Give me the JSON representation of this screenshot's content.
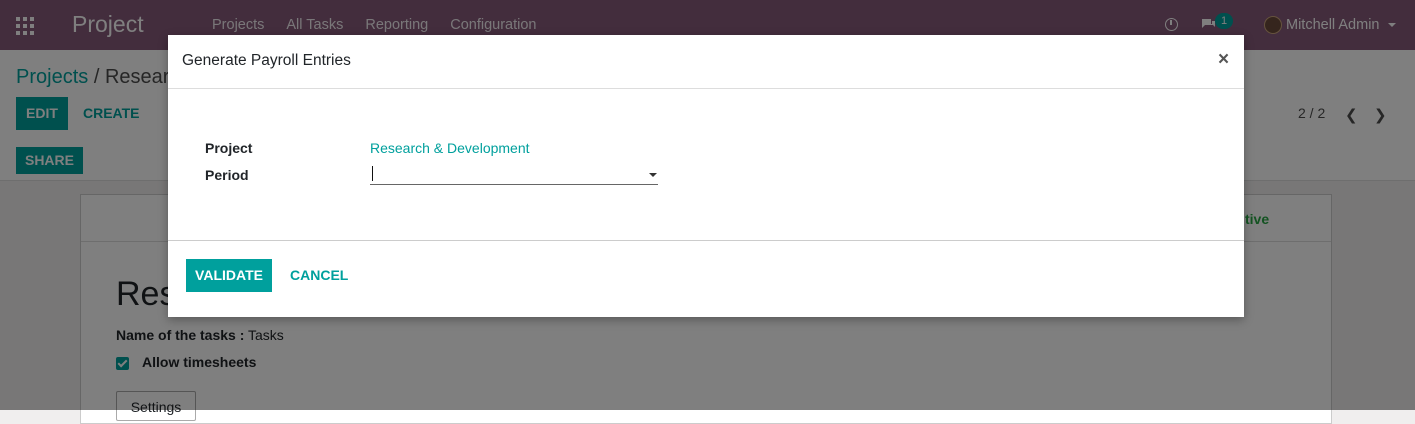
{
  "navbar": {
    "app_title": "Project",
    "menu": [
      "Projects",
      "All Tasks",
      "Reporting",
      "Configuration"
    ],
    "chat_count": "1",
    "user_name": "Mitchell Admin",
    "icons": {
      "apps": "apps-grid-icon",
      "activity": "clock-icon",
      "chat": "chat-bubbles-icon",
      "dropdown": "caret-down-icon"
    }
  },
  "control_panel": {
    "breadcrumb_root": "Projects",
    "breadcrumb_separator": "/",
    "breadcrumb_current": "Resear",
    "edit_label": "EDIT",
    "create_label": "CREATE",
    "share_label": "SHARE",
    "pager": "2 / 2",
    "prev_icon": "chevron-left-icon",
    "next_icon": "chevron-right-icon"
  },
  "form": {
    "status_label": "tive",
    "title": "Res",
    "tasks_name_label": "Name of the tasks :",
    "tasks_name_value": "Tasks",
    "allow_timesheets_label": "Allow timesheets",
    "allow_timesheets_checked": true,
    "settings_label": "Settings"
  },
  "modal": {
    "title": "Generate Payroll Entries",
    "close_symbol": "×",
    "fields": {
      "project_label": "Project",
      "project_value": "Research & Development",
      "period_label": "Period",
      "period_value": ""
    },
    "validate_label": "VALIDATE",
    "cancel_label": "CANCEL"
  },
  "colors": {
    "navbar": "#875a7b",
    "accent": "#00a09d",
    "overlay": "rgba(0,0,0,0.5)"
  }
}
